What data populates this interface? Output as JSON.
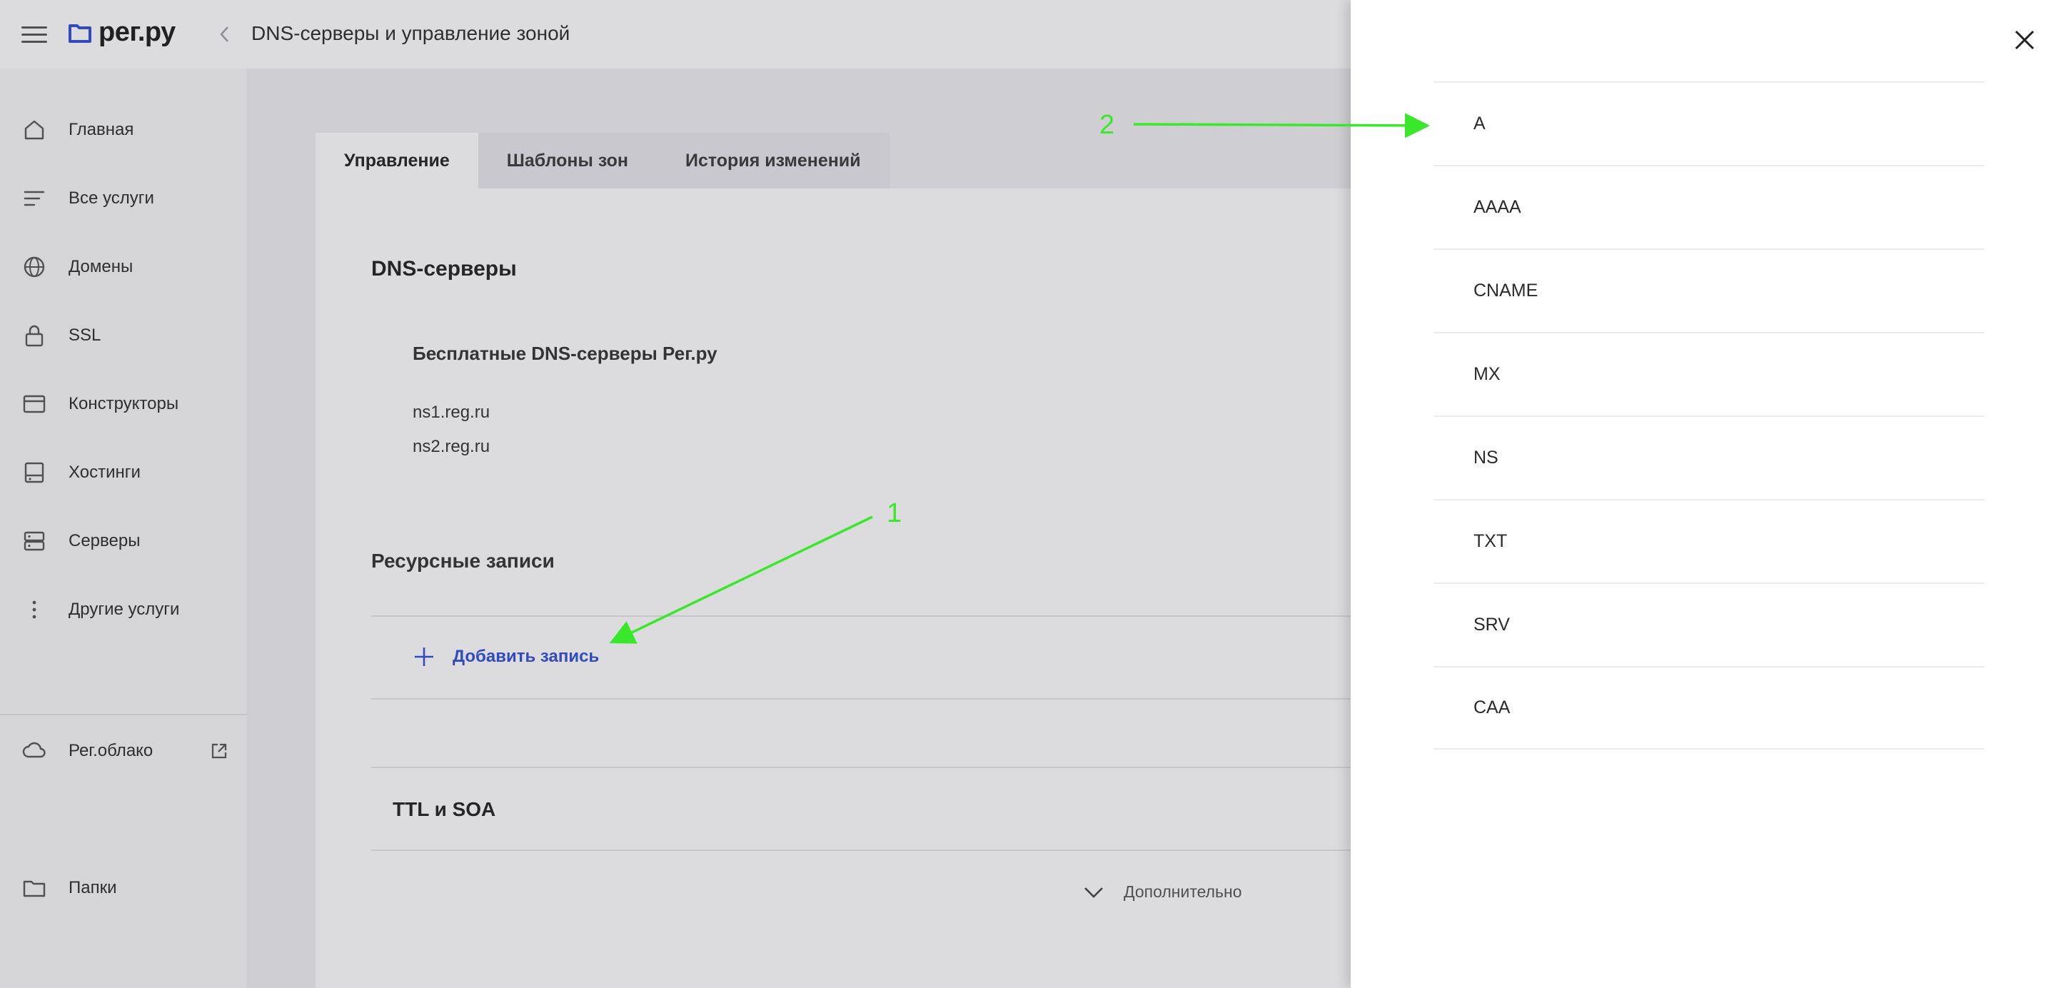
{
  "header": {
    "logo_text": "рег.ру",
    "title": "DNS-серверы и управление зоной"
  },
  "sidebar": {
    "items": [
      {
        "label": "Главная",
        "icon": "home-icon"
      },
      {
        "label": "Все услуги",
        "icon": "list-icon"
      },
      {
        "label": "Домены",
        "icon": "globe-icon"
      },
      {
        "label": "SSL",
        "icon": "lock-icon"
      },
      {
        "label": "Конструкторы",
        "icon": "browser-window-icon"
      },
      {
        "label": "Хостинги",
        "icon": "hosting-icon"
      },
      {
        "label": "Серверы",
        "icon": "server-icon"
      },
      {
        "label": "Другие услуги",
        "icon": "more-vertical-icon"
      }
    ],
    "cloud": {
      "label": "Рег.облако",
      "icon": "cloud-icon"
    },
    "folders": {
      "label": "Папки",
      "icon": "folder-icon"
    }
  },
  "main": {
    "tabs": [
      {
        "label": "Управление",
        "active": true
      },
      {
        "label": "Шаблоны зон",
        "active": false
      },
      {
        "label": "История изменений",
        "active": false
      }
    ],
    "dns_title": "DNS-серверы",
    "dns_free_title": "Бесплатные DNS-серверы Рег.ру",
    "nameservers": [
      "ns1.reg.ru",
      "ns2.reg.ru"
    ],
    "records_title": "Ресурсные записи",
    "add_record_label": "Добавить запись",
    "ttl_title": "TTL и SOA",
    "more_label": "Дополнительно"
  },
  "panel": {
    "record_types": [
      "A",
      "AAAA",
      "CNAME",
      "MX",
      "NS",
      "TXT",
      "SRV",
      "CAA"
    ]
  },
  "annotations": {
    "label_1": "1",
    "label_2": "2",
    "color": "#39e82a"
  },
  "colors": {
    "accent": "#2f4fd8",
    "annotation": "#39e82a"
  }
}
